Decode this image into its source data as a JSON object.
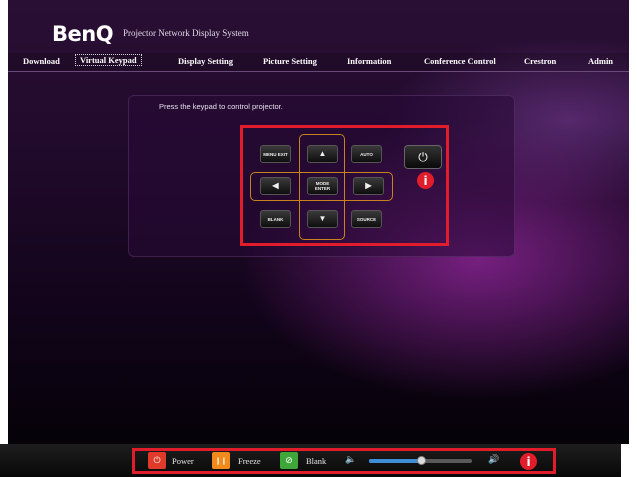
{
  "header": {
    "logo": "BenQ",
    "system_title": "Projector Network Display System"
  },
  "nav": {
    "tabs": [
      {
        "label": "Download",
        "active": false
      },
      {
        "label": "Virtual Keypad",
        "active": true
      },
      {
        "label": "Display Setting",
        "active": false
      },
      {
        "label": "Picture Setting",
        "active": false
      },
      {
        "label": "Information",
        "active": false
      },
      {
        "label": "Conference Control",
        "active": false
      },
      {
        "label": "Crestron",
        "active": false
      },
      {
        "label": "Admin",
        "active": false
      }
    ]
  },
  "keypad": {
    "message": "Press the keypad to control projector.",
    "menu_exit": "MENU EXIT",
    "up": "▲",
    "auto": "AUTO",
    "left": "◀",
    "mode_enter": "MODE ENTER",
    "right": "▶",
    "blank": "BLANK",
    "down": "▼",
    "source": "SOURCE",
    "power_icon": "⏻",
    "info_marker": "i"
  },
  "bottom_bar": {
    "power_label": "Power",
    "freeze_label": "Freeze",
    "blank_label": "Blank",
    "power_icon": "⏻",
    "freeze_icon": "❙❙",
    "blank_icon": "⊘",
    "volume_level": 0.5,
    "vol_down_icon": "🔈",
    "vol_up_icon": "🔊",
    "info_marker": "i"
  },
  "colors": {
    "highlight": "#e21d2b",
    "power": "#e03a2a",
    "freeze": "#f08a1c",
    "blank": "#3fa63a",
    "volume": "#3f8fd6"
  }
}
